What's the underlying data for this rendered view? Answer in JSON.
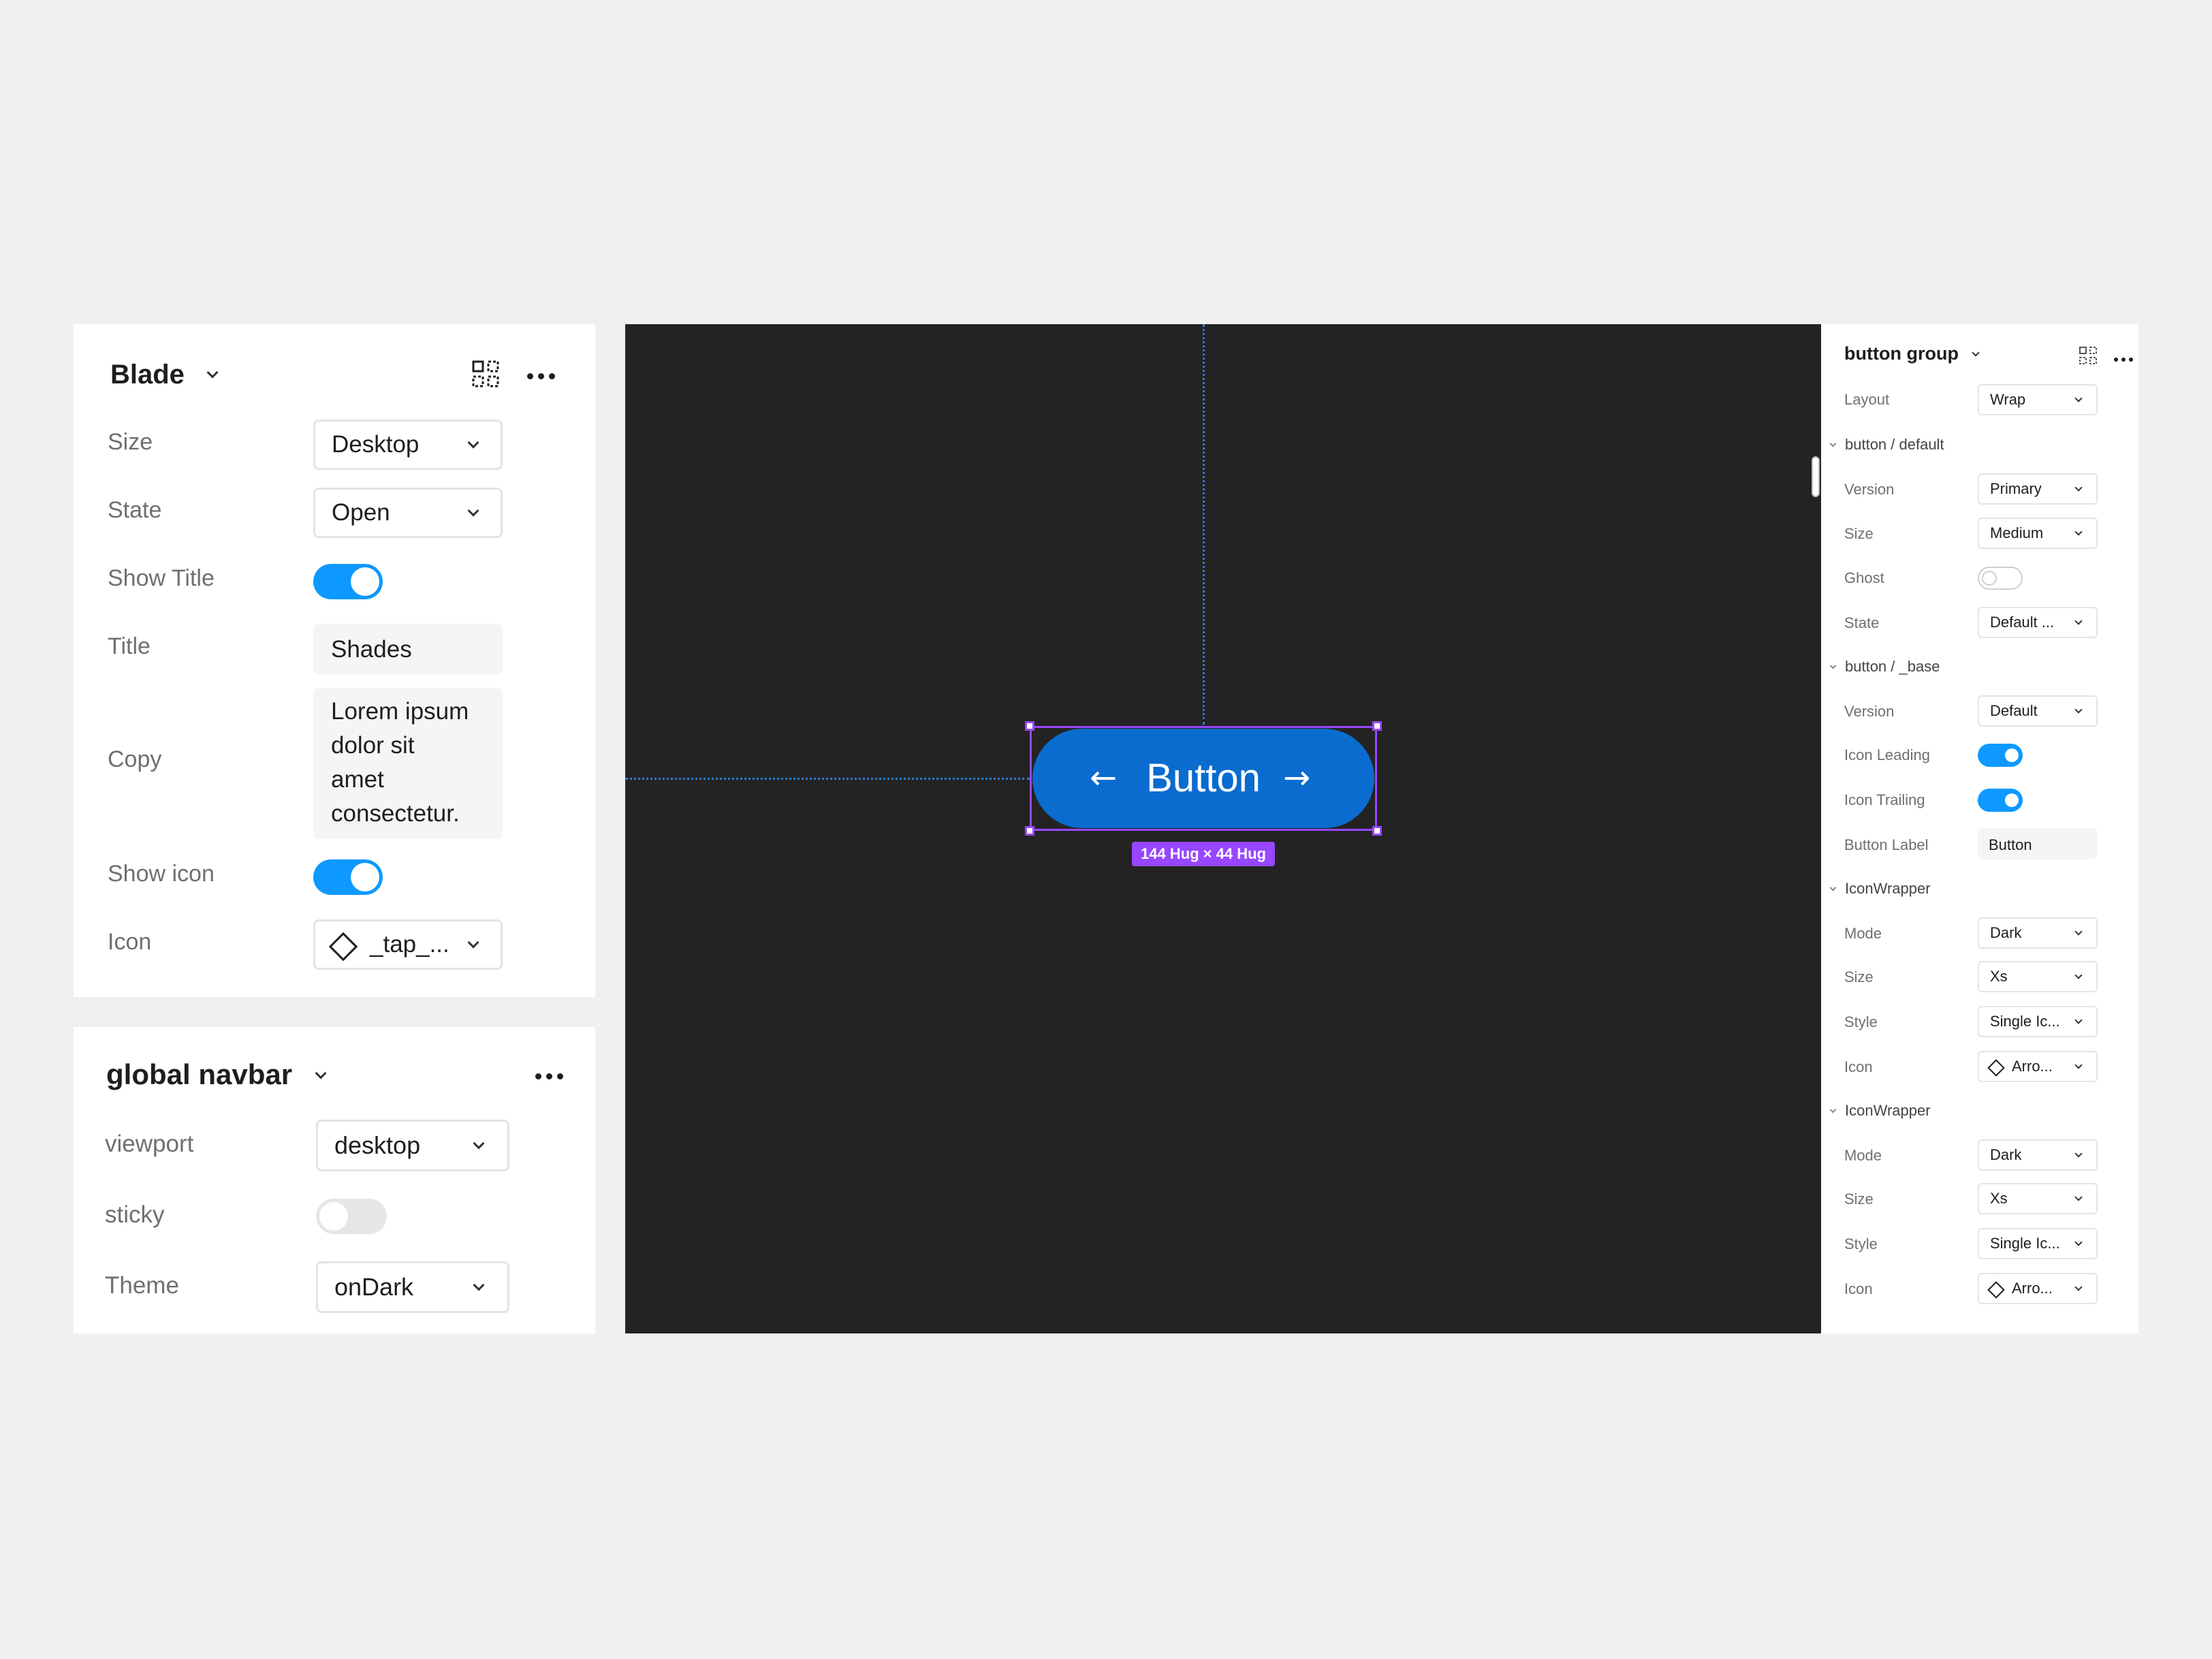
{
  "blade_panel": {
    "title": "Blade",
    "size": {
      "label": "Size",
      "value": "Desktop"
    },
    "state": {
      "label": "State",
      "value": "Open"
    },
    "show_title": {
      "label": "Show Title",
      "on": true
    },
    "title_field": {
      "label": "Title",
      "value": "Shades"
    },
    "copy": {
      "label": "Copy",
      "lines": [
        "Lorem ipsum",
        "dolor sit",
        "amet",
        "consectetur."
      ]
    },
    "show_icon": {
      "label": "Show icon",
      "on": true
    },
    "icon": {
      "label": "Icon",
      "value": "_tap_..."
    }
  },
  "navbar_panel": {
    "title": "global navbar",
    "viewport": {
      "label": "viewport",
      "value": "desktop"
    },
    "sticky": {
      "label": "sticky",
      "on": false
    },
    "theme": {
      "label": "Theme",
      "value": "onDark"
    }
  },
  "canvas": {
    "background": "#232323",
    "button": {
      "label": "Button",
      "leading_icon": "←",
      "trailing_icon": "→",
      "color": "#0a6ccf"
    },
    "size_badge": "144 Hug × 44 Hug",
    "selection_color": "#9747ff",
    "guide_color": "#2b7fd4"
  },
  "right_panel": {
    "title": "button group",
    "layout": {
      "label": "Layout",
      "value": "Wrap"
    },
    "section_default": "button / default",
    "version": {
      "label": "Version",
      "value": "Primary"
    },
    "size": {
      "label": "Size",
      "value": "Medium"
    },
    "ghost": {
      "label": "Ghost",
      "on": false
    },
    "state": {
      "label": "State",
      "value": "Default ..."
    },
    "section_base": "button / _base",
    "base_version": {
      "label": "Version",
      "value": "Default"
    },
    "icon_leading": {
      "label": "Icon Leading",
      "on": true
    },
    "icon_trailing": {
      "label": "Icon Trailing",
      "on": true
    },
    "button_label": {
      "label": "Button Label",
      "value": "Button"
    },
    "wrapper1": {
      "section": "IconWrapper",
      "mode": {
        "label": "Mode",
        "value": "Dark"
      },
      "size": {
        "label": "Size",
        "value": "Xs"
      },
      "style": {
        "label": "Style",
        "value": "Single Ic..."
      },
      "icon": {
        "label": "Icon",
        "value": "Arro..."
      }
    },
    "wrapper2": {
      "section": "IconWrapper",
      "mode": {
        "label": "Mode",
        "value": "Dark"
      },
      "size": {
        "label": "Size",
        "value": "Xs"
      },
      "style": {
        "label": "Style",
        "value": "Single Ic..."
      },
      "icon": {
        "label": "Icon",
        "value": "Arro..."
      }
    }
  },
  "icons": {
    "component_set": "component-grid-icon",
    "more": "ellipsis-icon",
    "dropdown": "chevron-down-icon",
    "icon_swap": "diamond-icon"
  },
  "colors": {
    "toggle_on": "#0d99ff",
    "toggle_off": "#e6e6e6",
    "panel_bg": "#ffffff",
    "page_bg": "#f0f0f0"
  }
}
